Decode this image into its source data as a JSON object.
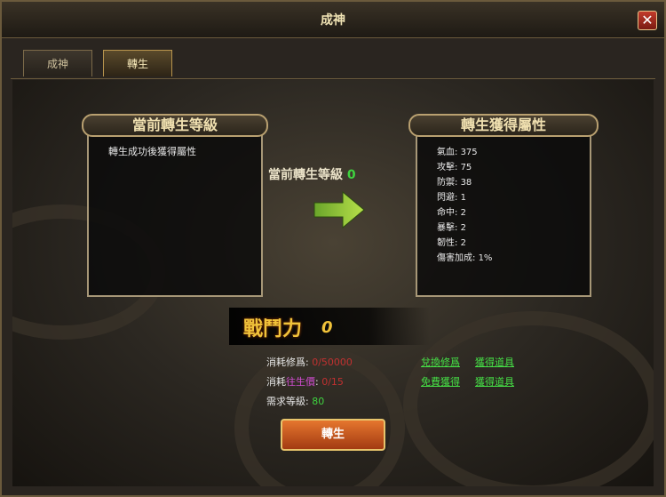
{
  "window": {
    "title": "成神",
    "close_label": "✕"
  },
  "tabs": [
    {
      "label": "成神"
    },
    {
      "label": "轉生"
    }
  ],
  "left_panel": {
    "title": "當前轉生等級",
    "text": "轉生成功後獲得屬性"
  },
  "right_panel": {
    "title": "轉生獲得屬性",
    "stats": [
      {
        "name": "氣血",
        "value": "375"
      },
      {
        "name": "攻擊",
        "value": "75"
      },
      {
        "name": "防禦",
        "value": "38"
      },
      {
        "name": "閃避",
        "value": "1"
      },
      {
        "name": "命中",
        "value": "2"
      },
      {
        "name": "暴擊",
        "value": "2"
      },
      {
        "name": "韌性",
        "value": "2"
      },
      {
        "name": "傷害加成",
        "value": "1%"
      }
    ]
  },
  "current_level": {
    "label": "當前轉生等級",
    "value": "0"
  },
  "power": {
    "label": "戰鬥力",
    "value": "0"
  },
  "costs": {
    "cultivation": {
      "label": "消耗修爲:",
      "value": "0/50000"
    },
    "token": {
      "label_prefix": "消耗",
      "label_item": "往生價",
      "value": "0/15"
    },
    "level": {
      "label": "需求等級:",
      "value": "80"
    }
  },
  "links": {
    "exchange_cultivation": "兌換修爲",
    "get_item_1": "獲得道具",
    "free_get": "免費獲得",
    "get_item_2": "獲得道具"
  },
  "button": {
    "label": "轉生"
  }
}
